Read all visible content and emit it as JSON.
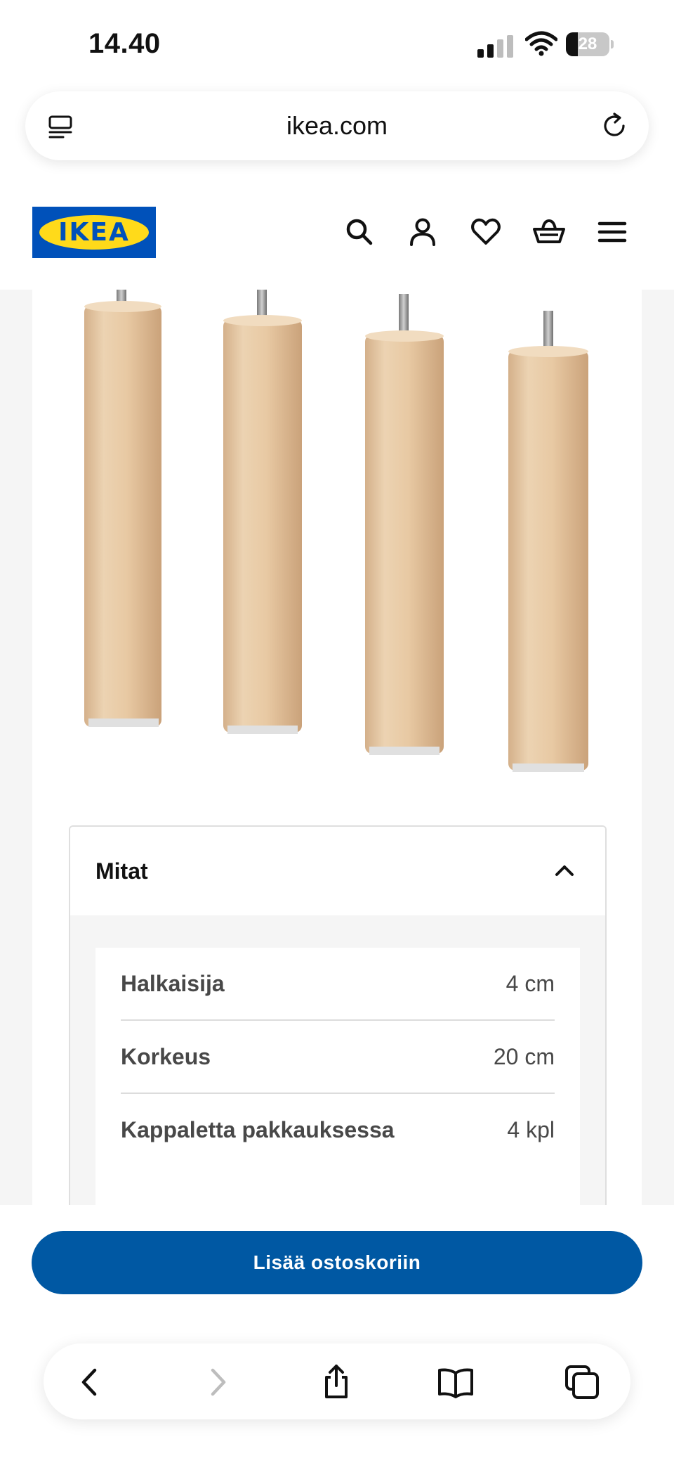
{
  "status_bar": {
    "time": "14.40",
    "battery": "28",
    "battery_level": 0.28
  },
  "browser": {
    "url": "ikea.com"
  },
  "header": {
    "logo_text": "IKEA"
  },
  "product": {
    "image_alt": "Four wooden furniture legs"
  },
  "dimensions": {
    "title": "Mitat",
    "rows": [
      {
        "label": "Halkaisija",
        "value": "4 cm"
      },
      {
        "label": "Korkeus",
        "value": "20 cm"
      },
      {
        "label": "Kappaletta pakkauksessa",
        "value": "4 kpl"
      }
    ]
  },
  "cta": {
    "label": "Lisää ostoskoriin"
  },
  "colors": {
    "ikea_blue": "#0058a3",
    "logo_blue": "#0051ba",
    "logo_yellow": "#ffda1a",
    "wood": "#e6c9a4"
  },
  "icons": {
    "header": [
      "search-icon",
      "account-icon",
      "heart-icon",
      "basket-icon",
      "menu-icon"
    ],
    "toolbar": [
      "back-icon",
      "forward-icon",
      "share-icon",
      "bookmarks-icon",
      "tabs-icon"
    ]
  }
}
